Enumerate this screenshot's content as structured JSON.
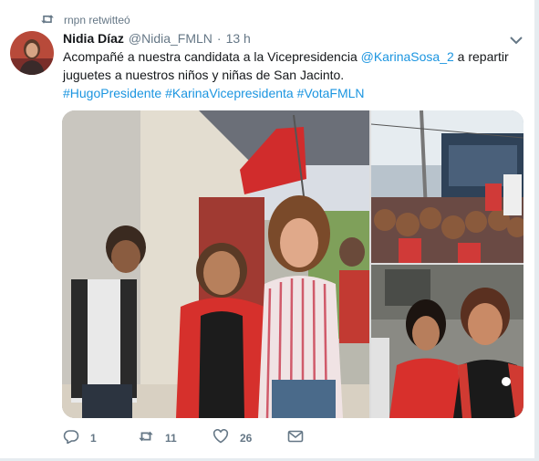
{
  "retweet_context": {
    "text": "rnpn retwitteó",
    "icon": "retweet-icon"
  },
  "tweet": {
    "author_name": "Nidia Díaz",
    "author_handle": "@Nidia_FMLN",
    "separator": "·",
    "time": "13 h",
    "text_parts": [
      {
        "text": "Acompañé a nuestra candidata a la Vicepresidencia ",
        "link": false
      },
      {
        "text": "@KarinaSosa_2",
        "link": true
      },
      {
        "text": " a repartir juguetes a nuestros niños y niñas de San Jacinto.",
        "link": false
      }
    ],
    "hashtags": [
      "#HugoPresidente",
      "#KarinaVicepresidenta",
      "#VotaFMLN"
    ]
  },
  "actions": {
    "reply_count": "1",
    "retweet_count": "11",
    "like_count": "26"
  },
  "colors": {
    "link": "#1b95e0",
    "secondary_text": "#657786",
    "primary_text": "#14171a"
  },
  "icons": [
    "retweet-icon",
    "chevron-down-icon",
    "reply-icon",
    "retweet-icon",
    "heart-icon",
    "mail-icon"
  ]
}
